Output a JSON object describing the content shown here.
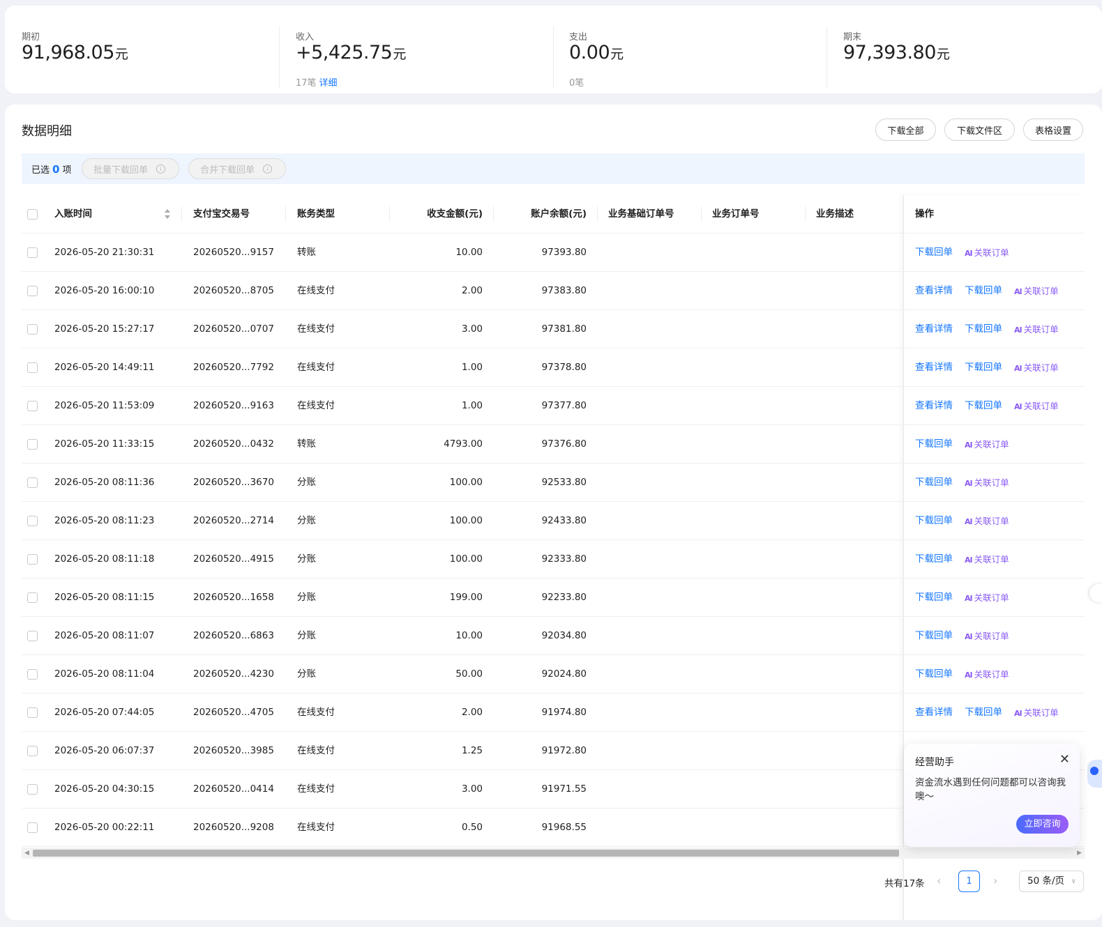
{
  "summary": {
    "opening": {
      "label": "期初",
      "value": "91,968.05",
      "unit": "元"
    },
    "income": {
      "label": "收入",
      "value": "+5,425.75",
      "unit": "元",
      "count": "17笔",
      "detail_link": "详细"
    },
    "expense": {
      "label": "支出",
      "value": "0.00",
      "unit": "元",
      "count": "0笔"
    },
    "closing": {
      "label": "期末",
      "value": "97,393.80",
      "unit": "元"
    }
  },
  "detail": {
    "title": "数据明细",
    "buttons": {
      "download_all": "下载全部",
      "download_files": "下载文件区",
      "table_settings": "表格设置"
    },
    "selection": {
      "prefix": "已选",
      "count": "0",
      "suffix": "项",
      "batch_download": "批量下载回单",
      "merge_download": "合并下载回单"
    },
    "columns": [
      "入账时间",
      "支付宝交易号",
      "账务类型",
      "收支金额(元)",
      "账户余额(元)",
      "业务基础订单号",
      "业务订单号",
      "业务描述",
      "操作"
    ],
    "action_labels": {
      "view": "查看详情",
      "download": "下载回单",
      "link": "关联订单",
      "ai": "AI"
    },
    "rows": [
      {
        "time": "2026-05-20 21:30:31",
        "trade_no": "20260520...9157",
        "type": "转账",
        "amount": "10.00",
        "balance": "97393.80",
        "actions": "dl"
      },
      {
        "time": "2026-05-20 16:00:10",
        "trade_no": "20260520...8705",
        "type": "在线支付",
        "amount": "2.00",
        "balance": "97383.80",
        "actions": "full"
      },
      {
        "time": "2026-05-20 15:27:17",
        "trade_no": "20260520...0707",
        "type": "在线支付",
        "amount": "3.00",
        "balance": "97381.80",
        "actions": "full"
      },
      {
        "time": "2026-05-20 14:49:11",
        "trade_no": "20260520...7792",
        "type": "在线支付",
        "amount": "1.00",
        "balance": "97378.80",
        "actions": "full"
      },
      {
        "time": "2026-05-20 11:53:09",
        "trade_no": "20260520...9163",
        "type": "在线支付",
        "amount": "1.00",
        "balance": "97377.80",
        "actions": "full"
      },
      {
        "time": "2026-05-20 11:33:15",
        "trade_no": "20260520...0432",
        "type": "转账",
        "amount": "4793.00",
        "balance": "97376.80",
        "actions": "dl"
      },
      {
        "time": "2026-05-20 08:11:36",
        "trade_no": "20260520...3670",
        "type": "分账",
        "amount": "100.00",
        "balance": "92533.80",
        "actions": "dl"
      },
      {
        "time": "2026-05-20 08:11:23",
        "trade_no": "20260520...2714",
        "type": "分账",
        "amount": "100.00",
        "balance": "92433.80",
        "actions": "dl"
      },
      {
        "time": "2026-05-20 08:11:18",
        "trade_no": "20260520...4915",
        "type": "分账",
        "amount": "100.00",
        "balance": "92333.80",
        "actions": "dl"
      },
      {
        "time": "2026-05-20 08:11:15",
        "trade_no": "20260520...1658",
        "type": "分账",
        "amount": "199.00",
        "balance": "92233.80",
        "actions": "dl"
      },
      {
        "time": "2026-05-20 08:11:07",
        "trade_no": "20260520...6863",
        "type": "分账",
        "amount": "10.00",
        "balance": "92034.80",
        "actions": "dl"
      },
      {
        "time": "2026-05-20 08:11:04",
        "trade_no": "20260520...4230",
        "type": "分账",
        "amount": "50.00",
        "balance": "92024.80",
        "actions": "dl"
      },
      {
        "time": "2026-05-20 07:44:05",
        "trade_no": "20260520...4705",
        "type": "在线支付",
        "amount": "2.00",
        "balance": "91974.80",
        "actions": "full"
      },
      {
        "time": "2026-05-20 06:07:37",
        "trade_no": "20260520...3985",
        "type": "在线支付",
        "amount": "1.25",
        "balance": "91972.80",
        "actions": "none"
      },
      {
        "time": "2026-05-20 04:30:15",
        "trade_no": "20260520...0414",
        "type": "在线支付",
        "amount": "3.00",
        "balance": "91971.55",
        "actions": "none"
      },
      {
        "time": "2026-05-20 00:22:11",
        "trade_no": "20260520...9208",
        "type": "在线支付",
        "amount": "0.50",
        "balance": "91968.55",
        "actions": "none"
      }
    ],
    "pagination": {
      "total": "共有17条",
      "current_page": "1",
      "page_size": "50 条/页"
    }
  },
  "assistant": {
    "title": "经营助手",
    "message": "资金流水遇到任何问题都可以咨询我噢～",
    "button": "立即咨询"
  },
  "colors": {
    "accent": "#1677ff",
    "ai_purple": "#8a5cf6",
    "selection_bg": "#eef5ff"
  }
}
